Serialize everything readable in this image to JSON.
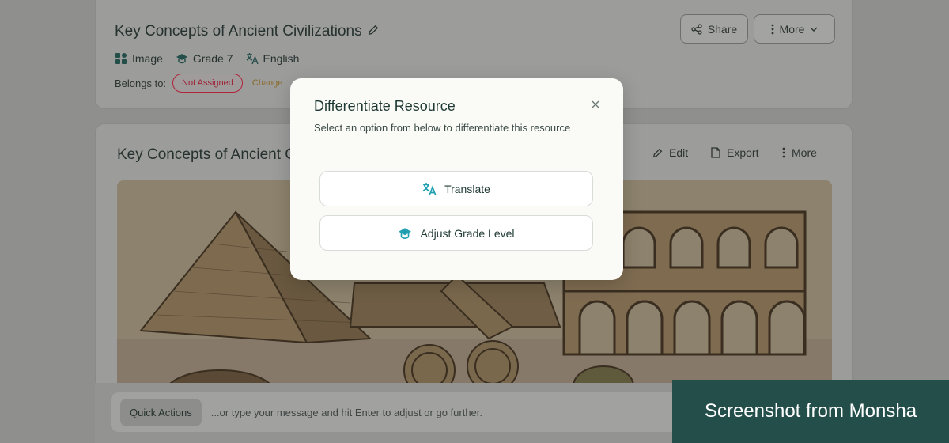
{
  "resource": {
    "title": "Key Concepts of Ancient Civilizations",
    "meta": [
      {
        "icon": "image-icon",
        "label": "Image"
      },
      {
        "icon": "grade-cap-icon",
        "label": "Grade 7"
      },
      {
        "icon": "translate-icon",
        "label": "English"
      }
    ],
    "belongs_label": "Belongs to:",
    "assignment_status": "Not Assigned",
    "change_link": "Change",
    "share_label": "Share",
    "more_label": "More"
  },
  "content_card": {
    "title": "Key Concepts of Ancient C",
    "edit_label": "Edit",
    "export_label": "Export",
    "more_label": "More"
  },
  "chat": {
    "quick_actions_label": "Quick Actions",
    "placeholder": "...or type your message and hit Enter to adjust or go further."
  },
  "watermark": "Screenshot from Monsha",
  "modal": {
    "title": "Differentiate Resource",
    "subtitle": "Select an option from below to differentiate this resource",
    "options": [
      {
        "icon": "translate-icon",
        "label": "Translate"
      },
      {
        "icon": "grade-cap-icon",
        "label": "Adjust Grade Level"
      }
    ]
  },
  "colors": {
    "accent": "#1f9fb0",
    "brand_dark": "#244e49",
    "danger": "#b0233a",
    "overlay": "#8f8f8d"
  }
}
